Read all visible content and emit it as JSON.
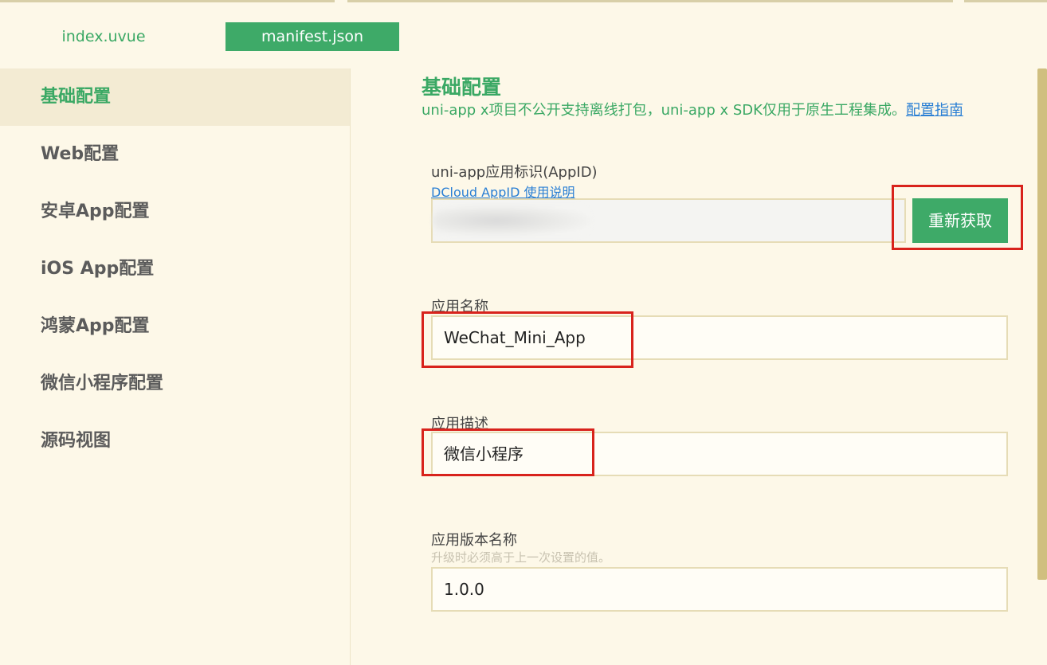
{
  "tabs": [
    {
      "label": "index.uvue",
      "active": false
    },
    {
      "label": "manifest.json",
      "active": true
    }
  ],
  "sidebar": {
    "items": [
      {
        "label": "基础配置",
        "active": true
      },
      {
        "label": "Web配置",
        "active": false
      },
      {
        "label": "安卓App配置",
        "active": false
      },
      {
        "label": "iOS App配置",
        "active": false
      },
      {
        "label": "鸿蒙App配置",
        "active": false
      },
      {
        "label": "微信小程序配置",
        "active": false
      },
      {
        "label": "源码视图",
        "active": false
      }
    ]
  },
  "section": {
    "title": "基础配置",
    "desc": "uni-app x项目不公开支持离线打包，uni-app x SDK仅用于原生工程集成。",
    "desc_link": "配置指南"
  },
  "fields": {
    "appid": {
      "label": "uni-app应用标识(AppID)",
      "link": "DCloud AppID 使用说明",
      "button": "重新获取"
    },
    "app_name": {
      "label": "应用名称",
      "value": "WeChat_Mini_App"
    },
    "app_desc": {
      "label": "应用描述",
      "value": "微信小程序"
    },
    "version_name": {
      "label": "应用版本名称",
      "hint": "升级时必须高于上一次设置的值。",
      "value": "1.0.0"
    }
  },
  "colors": {
    "accent": "#3eaa68",
    "background": "#fdf8e8",
    "highlight_box": "#d8231c",
    "link": "#2a7fd4"
  }
}
